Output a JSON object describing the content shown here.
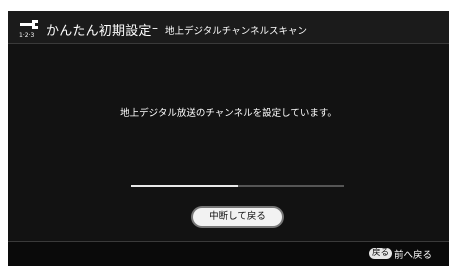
{
  "header": {
    "icon": "wrench-setup-icon",
    "icon_caption": "1·2·3",
    "title": "かんたん初期設定",
    "separator": "–",
    "subtitle": "地上デジタルチャンネルスキャン"
  },
  "main": {
    "message": "地上デジタル放送のチャンネルを設定しています。",
    "progress": 0.5,
    "stop_button_label": "中断して戻る"
  },
  "footer": {
    "back_key_label": "戻る",
    "back_label": "前へ戻る"
  },
  "colors": {
    "background": "#0e0e0e",
    "header": "#1b1b1b",
    "text": "#ffffff",
    "progress_fill": "#e8e8e8",
    "progress_track": "#555555"
  }
}
